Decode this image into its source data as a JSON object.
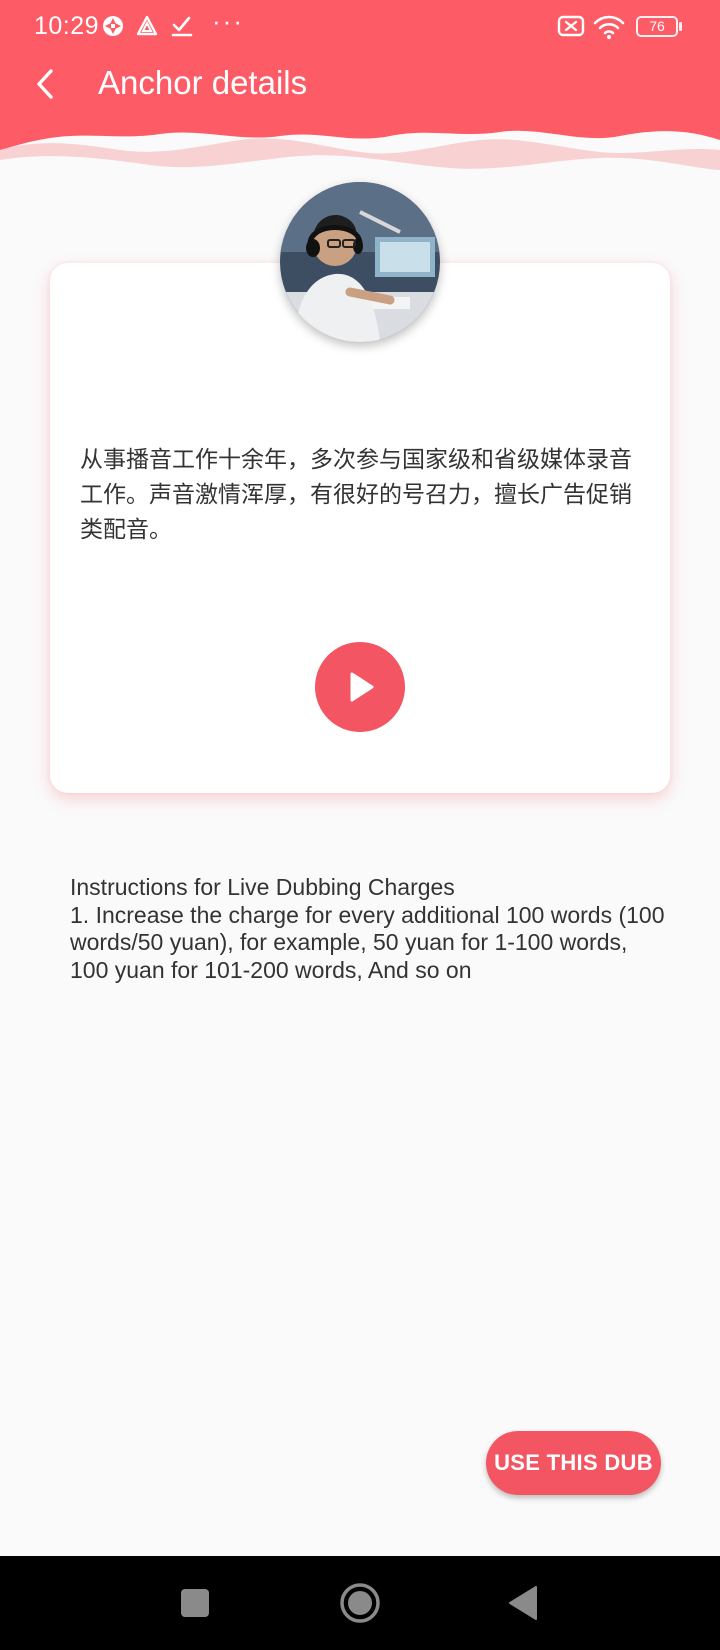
{
  "status_bar": {
    "time": "10:29",
    "more_indicator": "···",
    "battery_level": "76",
    "icons": [
      "sync-icon",
      "delta-icon",
      "check-icon",
      "sim-off-icon",
      "wifi-icon",
      "battery-icon"
    ]
  },
  "app_bar": {
    "title": "Anchor details",
    "back_icon": "chevron-left-icon"
  },
  "anchor": {
    "avatar_icon": "avatar-photo",
    "bio": "从事播音工作十余年，多次参与国家级和省级媒体录音工作。声音激情浑厚，有很好的号召力，擅长广告促销类配音。",
    "play_icon": "play-icon"
  },
  "instructions": {
    "title": "Instructions for Live Dubbing Charges",
    "body": "1. Increase the charge for every additional 100 words (100 words/50 yuan), for example, 50 yuan for 1-100 words, 100 yuan for 101-200 words, And so on"
  },
  "actions": {
    "use_dub_label": "USE THIS DUB"
  },
  "nav_bar": {
    "recents_icon": "square-icon",
    "home_icon": "circle-icon",
    "back_icon": "triangle-back-icon"
  },
  "colors": {
    "accent": "#f35563",
    "header": "#fd5b66",
    "background": "#fafafa"
  }
}
